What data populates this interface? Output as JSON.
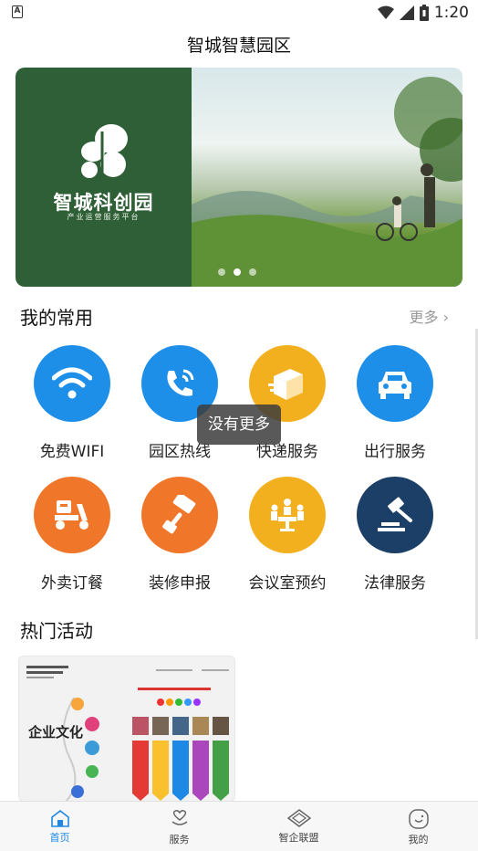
{
  "status_bar": {
    "time": "1:20"
  },
  "header": {
    "title": "智城智慧园区"
  },
  "banner": {
    "brand": "智城科创园",
    "subtitle": "产业运营服务平台",
    "dots": 3,
    "active_dot": 1
  },
  "favorites": {
    "heading": "我的常用",
    "more_label": "更多",
    "items": [
      {
        "label": "免费WIFI",
        "icon": "wifi-icon",
        "color": "#1e8fe8"
      },
      {
        "label": "园区热线",
        "icon": "phone-icon",
        "color": "#1e8fe8"
      },
      {
        "label": "快递服务",
        "icon": "package-icon",
        "color": "#f3b01e"
      },
      {
        "label": "出行服务",
        "icon": "car-icon",
        "color": "#1e8fe8"
      },
      {
        "label": "外卖订餐",
        "icon": "scooter-icon",
        "color": "#f0762a"
      },
      {
        "label": "装修申报",
        "icon": "paint-roller-icon",
        "color": "#f0762a"
      },
      {
        "label": "会议室预约",
        "icon": "meeting-icon",
        "color": "#f3b01e"
      },
      {
        "label": "法律服务",
        "icon": "gavel-icon",
        "color": "#1b3f66"
      }
    ]
  },
  "toast": {
    "text": "没有更多"
  },
  "activities": {
    "heading": "热门活动",
    "card_title": "企业文化"
  },
  "tabbar": {
    "tabs": [
      {
        "label": "首页",
        "icon": "home-icon",
        "active": true
      },
      {
        "label": "服务",
        "icon": "heart-hand-icon",
        "active": false
      },
      {
        "label": "智企联盟",
        "icon": "diamond-icon",
        "active": false
      },
      {
        "label": "我的",
        "icon": "face-icon",
        "active": false
      }
    ]
  }
}
